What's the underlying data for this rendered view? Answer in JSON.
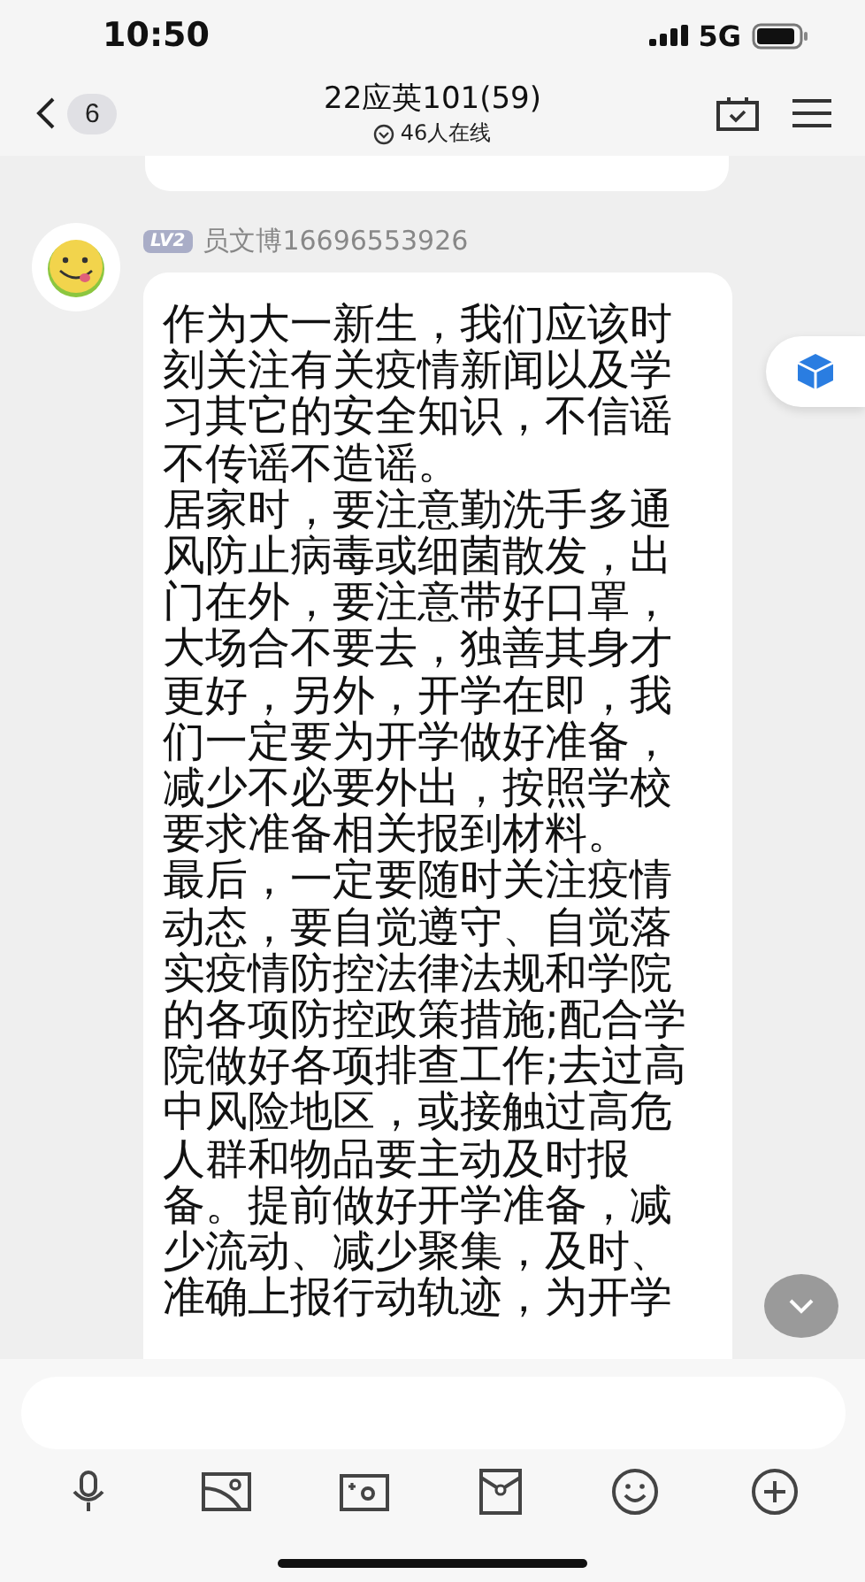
{
  "status_bar": {
    "time": "10:50",
    "network": "5G"
  },
  "header": {
    "back_count": "6",
    "title": "22应英101(59)",
    "online": "46人在线"
  },
  "messages": [
    {
      "kind": "tail"
    },
    {
      "kind": "full",
      "level_badge": "LV2",
      "sender": "员文博16696553926",
      "lines": [
        "作为大一新生，我们应该时",
        "刻关注有关疫情新闻以及学",
        "习其它的安全知识，不信谣",
        "不传谣不造谣。",
        "居家时，要注意勤洗手多通",
        "风防止病毒或细菌散发，出",
        "门在外，要注意带好口罩，",
        "大场合不要去，独善其身才",
        "更好，另外，开学在即，我",
        "们一定要为开学做好准备，",
        "减少不必要外出，按照学校",
        "要求准备相关报到材料。",
        "最后，一定要随时关注疫情",
        "动态，要自觉遵守、自觉落",
        "实疫情防控法律法规和学院",
        "的各项防控政策措施;配合学",
        "院做好各项排查工作;去过高",
        "中风险地区，或接触过高危",
        "人群和物品要主动及时报",
        "备。提前做好开学准备，减",
        "少流动、减少聚集，及时、",
        "准确上报行动轨迹，为开学"
      ]
    }
  ]
}
